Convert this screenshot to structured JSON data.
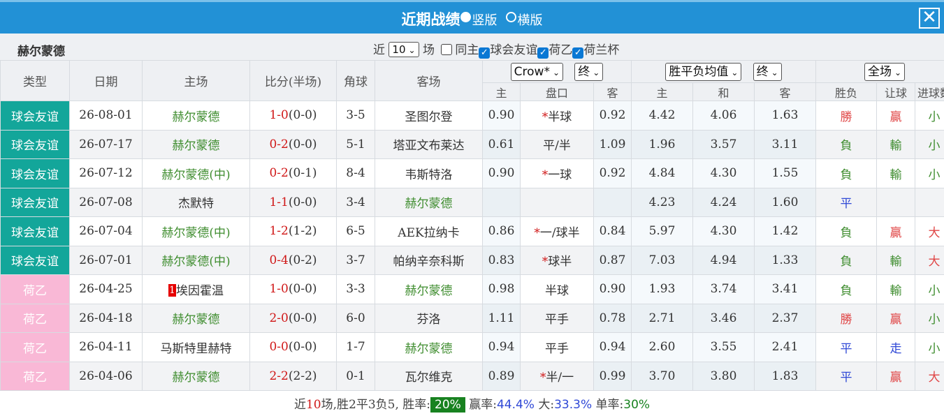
{
  "header": {
    "title": "近期战绩",
    "view_option_1": "竖版",
    "view_option_2": "横版",
    "close": "✕"
  },
  "filter": {
    "team": "赫尔蒙德",
    "prefix": "近",
    "count": "10",
    "unit": "场",
    "same_home": "同主",
    "competitions": [
      "球会友谊",
      "荷乙",
      "荷兰杯"
    ]
  },
  "columns": {
    "type": "类型",
    "date": "日期",
    "home": "主场",
    "score": "比分(半场)",
    "corner": "角球",
    "away": "客场",
    "ah_company": "Crow*",
    "ah_period": "终",
    "eu_company": "胜平负均值",
    "eu_period": "终",
    "scope": "全场",
    "ah_home": "主",
    "ah_line": "盘口",
    "ah_away": "客",
    "eu_home": "主",
    "eu_draw": "和",
    "eu_away": "客",
    "res_wl": "胜负",
    "res_ah": "让球",
    "res_ou": "进球数"
  },
  "rows": [
    {
      "type": "球会友谊",
      "kind": "club",
      "date": "26-08-01",
      "home": "赫尔蒙德",
      "home_rank": "",
      "score": "1-0",
      "half": "(0-0)",
      "corner": "3-5",
      "away": "圣图尔登",
      "ah_h": "0.90",
      "ah_star": "*",
      "ah_line": "半球",
      "ah_a": "0.92",
      "eu_h": "4.42",
      "eu_d": "4.06",
      "eu_a": "1.63",
      "wl": "勝",
      "ah_res": "贏",
      "ou": "小",
      "team_side": "home"
    },
    {
      "type": "球会友谊",
      "kind": "club",
      "date": "26-07-17",
      "home": "赫尔蒙德",
      "home_rank": "",
      "score": "0-2",
      "half": "(0-0)",
      "corner": "5-1",
      "away": "塔亚文布莱达",
      "ah_h": "0.61",
      "ah_star": "",
      "ah_line": "平/半",
      "ah_a": "1.09",
      "eu_h": "1.96",
      "eu_d": "3.57",
      "eu_a": "3.11",
      "wl": "負",
      "ah_res": "輸",
      "ou": "小",
      "team_side": "home"
    },
    {
      "type": "球会友谊",
      "kind": "club",
      "date": "26-07-12",
      "home": "赫尔蒙德(中)",
      "home_rank": "",
      "score": "0-2",
      "half": "(0-1)",
      "corner": "8-4",
      "away": "韦斯特洛",
      "ah_h": "0.90",
      "ah_star": "*",
      "ah_line": "一球",
      "ah_a": "0.92",
      "eu_h": "4.84",
      "eu_d": "4.30",
      "eu_a": "1.55",
      "wl": "負",
      "ah_res": "輸",
      "ou": "小",
      "team_side": "home"
    },
    {
      "type": "球会友谊",
      "kind": "club",
      "date": "26-07-08",
      "home": "杰默特",
      "home_rank": "",
      "score": "1-1",
      "half": "(0-0)",
      "corner": "3-4",
      "away": "赫尔蒙德",
      "ah_h": "",
      "ah_star": "",
      "ah_line": "",
      "ah_a": "",
      "eu_h": "4.23",
      "eu_d": "4.24",
      "eu_a": "1.60",
      "wl": "平",
      "ah_res": "",
      "ou": "",
      "team_side": "away"
    },
    {
      "type": "球会友谊",
      "kind": "club",
      "date": "26-07-04",
      "home": "赫尔蒙德(中)",
      "home_rank": "",
      "score": "1-2",
      "half": "(1-2)",
      "corner": "6-5",
      "away": "AEK拉纳卡",
      "ah_h": "0.86",
      "ah_star": "*",
      "ah_line": "一/球半",
      "ah_a": "0.84",
      "eu_h": "5.97",
      "eu_d": "4.30",
      "eu_a": "1.42",
      "wl": "負",
      "ah_res": "贏",
      "ou": "大",
      "team_side": "home"
    },
    {
      "type": "球会友谊",
      "kind": "club",
      "date": "26-07-01",
      "home": "赫尔蒙德(中)",
      "home_rank": "",
      "score": "0-4",
      "half": "(0-2)",
      "corner": "3-7",
      "away": "帕纳辛奈科斯",
      "ah_h": "0.83",
      "ah_star": "*",
      "ah_line": "球半",
      "ah_a": "0.87",
      "eu_h": "7.03",
      "eu_d": "4.94",
      "eu_a": "1.33",
      "wl": "負",
      "ah_res": "輸",
      "ou": "大",
      "team_side": "home"
    },
    {
      "type": "荷乙",
      "kind": "league",
      "date": "26-04-25",
      "home": "埃因霍温",
      "home_rank": "1",
      "score": "1-0",
      "half": "(0-0)",
      "corner": "3-3",
      "away": "赫尔蒙德",
      "ah_h": "0.98",
      "ah_star": "",
      "ah_line": "半球",
      "ah_a": "0.90",
      "eu_h": "1.93",
      "eu_d": "3.74",
      "eu_a": "3.41",
      "wl": "負",
      "ah_res": "輸",
      "ou": "小",
      "team_side": "away"
    },
    {
      "type": "荷乙",
      "kind": "league",
      "date": "26-04-18",
      "home": "赫尔蒙德",
      "home_rank": "",
      "score": "2-0",
      "half": "(0-0)",
      "corner": "6-0",
      "away": "芬洛",
      "ah_h": "1.11",
      "ah_star": "",
      "ah_line": "平手",
      "ah_a": "0.78",
      "eu_h": "2.71",
      "eu_d": "3.46",
      "eu_a": "2.37",
      "wl": "勝",
      "ah_res": "贏",
      "ou": "小",
      "team_side": "home"
    },
    {
      "type": "荷乙",
      "kind": "league",
      "date": "26-04-11",
      "home": "马斯特里赫特",
      "home_rank": "",
      "score": "0-0",
      "half": "(0-0)",
      "corner": "1-7",
      "away": "赫尔蒙德",
      "ah_h": "0.94",
      "ah_star": "",
      "ah_line": "平手",
      "ah_a": "0.94",
      "eu_h": "2.60",
      "eu_d": "3.55",
      "eu_a": "2.41",
      "wl": "平",
      "ah_res": "走",
      "ou": "小",
      "team_side": "away"
    },
    {
      "type": "荷乙",
      "kind": "league",
      "date": "26-04-06",
      "home": "赫尔蒙德",
      "home_rank": "",
      "score": "2-2",
      "half": "(2-2)",
      "corner": "0-1",
      "away": "瓦尔维克",
      "ah_h": "0.89",
      "ah_star": "*",
      "ah_line": "半/一",
      "ah_a": "0.99",
      "eu_h": "3.70",
      "eu_d": "3.80",
      "eu_a": "1.83",
      "wl": "平",
      "ah_res": "贏",
      "ou": "大",
      "team_side": "home"
    }
  ],
  "summary": {
    "p1": "近",
    "games": "10",
    "p2": "场,胜",
    "wins": "2",
    "p3": "平",
    "draws": "3",
    "p4": "负",
    "losses": "5",
    "p5": ", 胜率:",
    "win_rate": "20%",
    "p6": " 赢率:",
    "cover_rate": "44.4%",
    "p7": " 大:",
    "over_rate": "33.3%",
    "p8": " 单率:",
    "odd_rate": "30%"
  },
  "colors": {
    "title_bar": "#2291d6",
    "club_type": "#13a69a",
    "league_type": "#f9b8d6",
    "win_rate_badge": "#188220"
  }
}
